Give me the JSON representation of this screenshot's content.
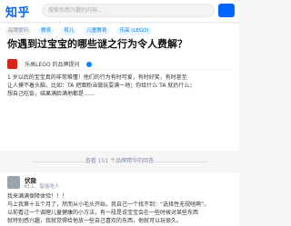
{
  "header": {
    "logo": "知乎",
    "search_placeholder": "搜索你感兴趣的内容…"
  },
  "question": {
    "tags": [
      "品牌提问",
      "教育",
      "育儿",
      "儿童教育",
      "乐高 (LEGO)"
    ],
    "title": "你遇到过宝宝的哪些谜之行为令人费解？",
    "asker": "乐高LEGO 的品牌提问",
    "body": [
      "1 岁以后的宝宝真的非常难懂！他们的行为有时可爱，有时好笑，有时甚至",
      "让人摸不着头脑，比如：TA 把面粉当做玩耍满一地；你给什么 TA 就扔什么；",
      "想自己吃饭，结果满脸满地都是……"
    ]
  },
  "see_all": "查看 151 个品牌精华的回答",
  "answer": {
    "author": "伏隐",
    "bio": "码工、智能吃人",
    "body": [
      "我来满满保障体验！！！",
      "马上我第十五个月了，然而从小毛头开始，我自己一个找不到：“选择性无视啥啊”。",
      "以前看过一个调理儿童健康的小方法，有一段是说宝宝会在一些时候对某些东西",
      "就特别感兴趣，我就觉得给他放一些自己喜欢的东西，他就可以玩很久。"
    ]
  }
}
